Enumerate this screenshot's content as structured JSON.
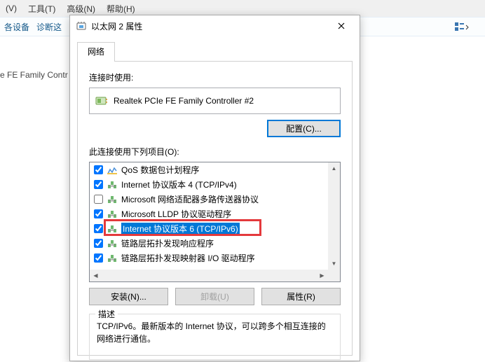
{
  "bg": {
    "menu": {
      "view": "(V)",
      "tools": "工具(T)",
      "advanced": "高级(N)",
      "help": "帮助(H)"
    },
    "toolbar": {
      "device": "各设备",
      "diagnose": "诊断这"
    },
    "content_line": "e FE Family Contr"
  },
  "dialog": {
    "title": "以太网 2 属性",
    "tab_network": "网络",
    "connect_using_label": "连接时使用:",
    "adapter_name": "Realtek PCIe FE Family Controller #2",
    "configure_btn": "配置(C)...",
    "uses_items_label": "此连接使用下列项目(O):",
    "items": [
      {
        "checked": true,
        "icon": "qos",
        "label": "QoS 数据包计划程序"
      },
      {
        "checked": true,
        "icon": "proto",
        "label": "Internet 协议版本 4 (TCP/IPv4)"
      },
      {
        "checked": false,
        "icon": "proto",
        "label": "Microsoft 网络适配器多路传送器协议"
      },
      {
        "checked": true,
        "icon": "proto",
        "label": "Microsoft LLDP 协议驱动程序"
      },
      {
        "checked": true,
        "icon": "proto",
        "label": "Internet 协议版本 6 (TCP/IPv6)",
        "selected": true
      },
      {
        "checked": true,
        "icon": "proto",
        "label": "链路层拓扑发现响应程序"
      },
      {
        "checked": true,
        "icon": "proto",
        "label": "链路层拓扑发现映射器 I/O 驱动程序"
      }
    ],
    "install_btn": "安装(N)...",
    "uninstall_btn": "卸载(U)",
    "properties_btn": "属性(R)",
    "desc_legend": "描述",
    "desc_text": "TCP/IPv6。最新版本的 Internet 协议，可以跨多个相互连接的网络进行通信。"
  }
}
